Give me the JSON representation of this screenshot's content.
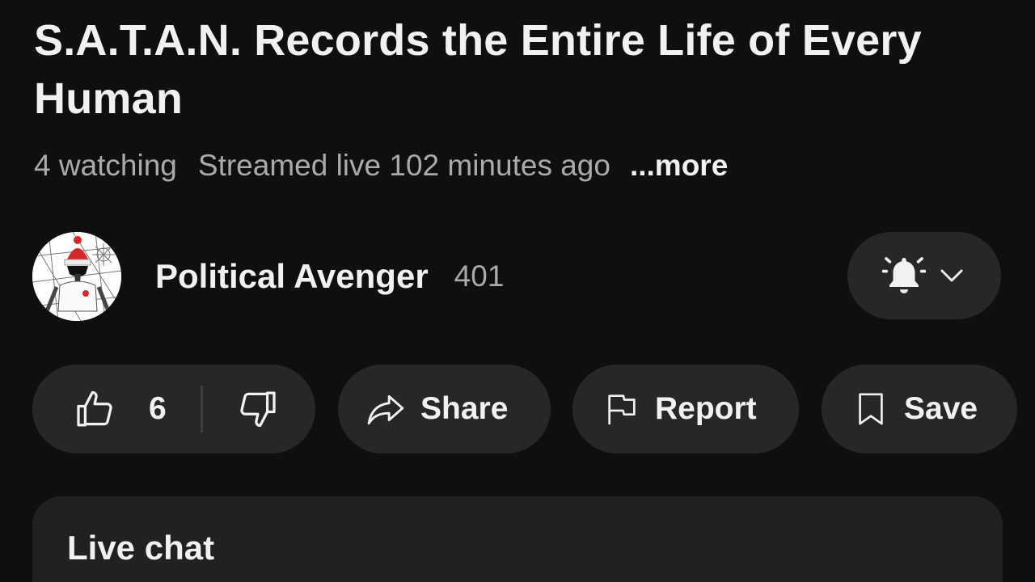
{
  "video": {
    "title": "S.A.T.A.N. Records the Entire Life of Every Human",
    "watching": "4 watching",
    "streamed": "Streamed live 102 minutes ago",
    "more_label": "...more"
  },
  "channel": {
    "name": "Political Avenger",
    "subscribers": "401",
    "notification_icon": "bell-icon",
    "dropdown_icon": "chevron-down-icon"
  },
  "actions": {
    "like_count": "6",
    "share_label": "Share",
    "report_label": "Report",
    "save_label": "Save"
  },
  "live_chat": {
    "title": "Live chat"
  },
  "colors": {
    "background": "#0f0f0f",
    "pill": "#272727",
    "card": "#212121",
    "text_primary": "#f1f1f1",
    "text_secondary": "#aaaaaa",
    "avatar_hat": "#d6282b"
  }
}
